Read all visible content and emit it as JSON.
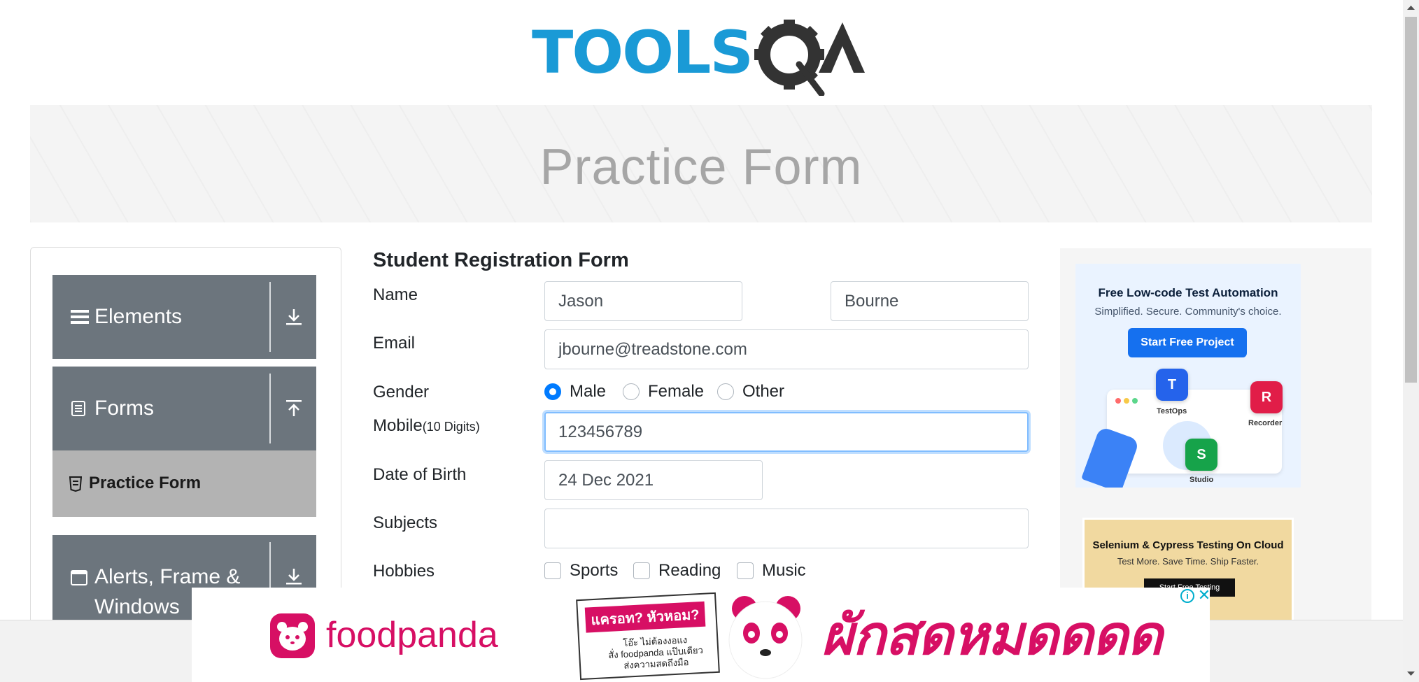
{
  "header": {
    "logo_text_tools": "TOOLS",
    "logo_text_qa": "QA"
  },
  "banner": {
    "title": "Practice Form"
  },
  "sidebar": {
    "groups": [
      {
        "label": "Elements",
        "icon": "hamburger-icon",
        "arrow": "download-arrow-icon"
      },
      {
        "label": "Forms",
        "icon": "document-icon",
        "arrow": "upload-arrow-icon"
      },
      {
        "label": "Alerts, Frame &\nWindows",
        "icon": "window-icon",
        "arrow": "download-arrow-icon"
      }
    ],
    "active_item": {
      "label": "Practice Form",
      "icon": "html5-icon"
    }
  },
  "form": {
    "title": "Student Registration Form",
    "name_label": "Name",
    "first_name": "Jason",
    "last_name": "Bourne",
    "email_label": "Email",
    "email": "jbourne@treadstone.com",
    "gender_label": "Gender",
    "gender_options": [
      "Male",
      "Female",
      "Other"
    ],
    "gender_selected": "Male",
    "mobile_label": "Mobile",
    "mobile_hint": "(10 Digits)",
    "mobile": "123456789",
    "dob_label": "Date of Birth",
    "dob": "24 Dec 2021",
    "subjects_label": "Subjects",
    "subjects": "",
    "hobbies_label": "Hobbies",
    "hobbies": [
      "Sports",
      "Reading",
      "Music"
    ]
  },
  "ads": {
    "right1": {
      "title": "Free Low-code Test Automation",
      "subtitle": "Simplified. Secure. Community's choice.",
      "button": "Start Free Project",
      "tags": [
        "TestOps",
        "Recorder",
        "Studio"
      ]
    },
    "right2": {
      "title": "Selenium & Cypress Testing On Cloud",
      "subtitle": "Test More. Save Time. Ship Faster.",
      "button": "Start Free Testing"
    },
    "bottom": {
      "brand": "foodpanda",
      "sticker_headline": "แครอท? หัวหอม?",
      "sticker_body": "โอ๊ะ ไม่ต้องงอแง\nสั่ง foodpanda แป๊บเดียว\nส่งความสดถึงมือ",
      "headline": "ผักสดหมดดดด"
    }
  },
  "colors": {
    "sidebar_group": "#6c757d",
    "sidebar_active": "#b3b3b3",
    "radio_selected": "#007bff",
    "logo_blue": "#1a9ad6",
    "logo_dark": "#333333",
    "foodpanda_pink": "#d70f64"
  }
}
